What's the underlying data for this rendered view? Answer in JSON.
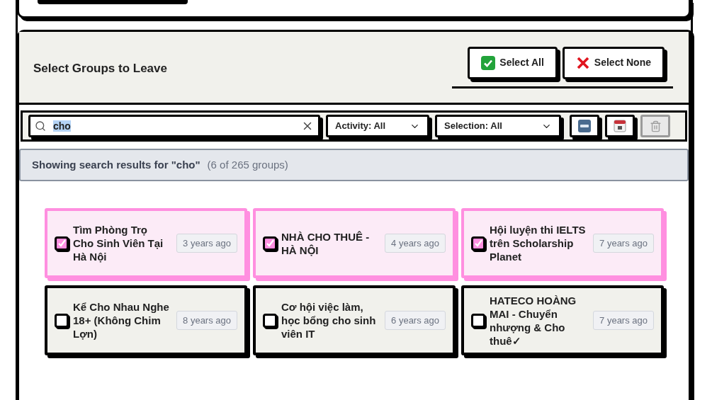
{
  "panel": {
    "title": "Select Groups to Leave",
    "buttons": [
      {
        "kind": "select-all",
        "label": "Select All"
      },
      {
        "kind": "select-none",
        "label": "Select None"
      }
    ]
  },
  "toolbar": {
    "search": {
      "value": "cho"
    },
    "filters": [
      {
        "label": "Activity: All"
      },
      {
        "label": "Selection: All"
      }
    ],
    "icon_buttons": [
      {
        "kind": "sort-alpha",
        "disabled": false
      },
      {
        "kind": "sort-date",
        "disabled": false
      },
      {
        "kind": "delete",
        "disabled": true
      }
    ]
  },
  "results": {
    "text": "Showing search results for \"cho\"",
    "count": "(6 of 265 groups)"
  },
  "groups": [
    {
      "name": "Tìm Phòng Trọ Cho Sinh Viên Tại Hà Nội",
      "age": "3 years ago",
      "selected": true
    },
    {
      "name": "NHÀ CHO THUÊ - HÀ NỘI",
      "age": "4 years ago",
      "selected": true
    },
    {
      "name": "Hội luyện thi IELTS trên Scholarship Planet",
      "age": "7 years ago",
      "selected": true
    },
    {
      "name": "Kể Cho Nhau Nghe 18+ (Không Chim Lợn)",
      "age": "8 years ago",
      "selected": false
    },
    {
      "name": "Cơ hội việc làm, học bổng cho sinh viên IT",
      "age": "6 years ago",
      "selected": false
    },
    {
      "name": "HATECO HOÀNG MAI - Chuyển nhượng & Cho thuê✓",
      "age": "7 years ago",
      "selected": false
    }
  ]
}
